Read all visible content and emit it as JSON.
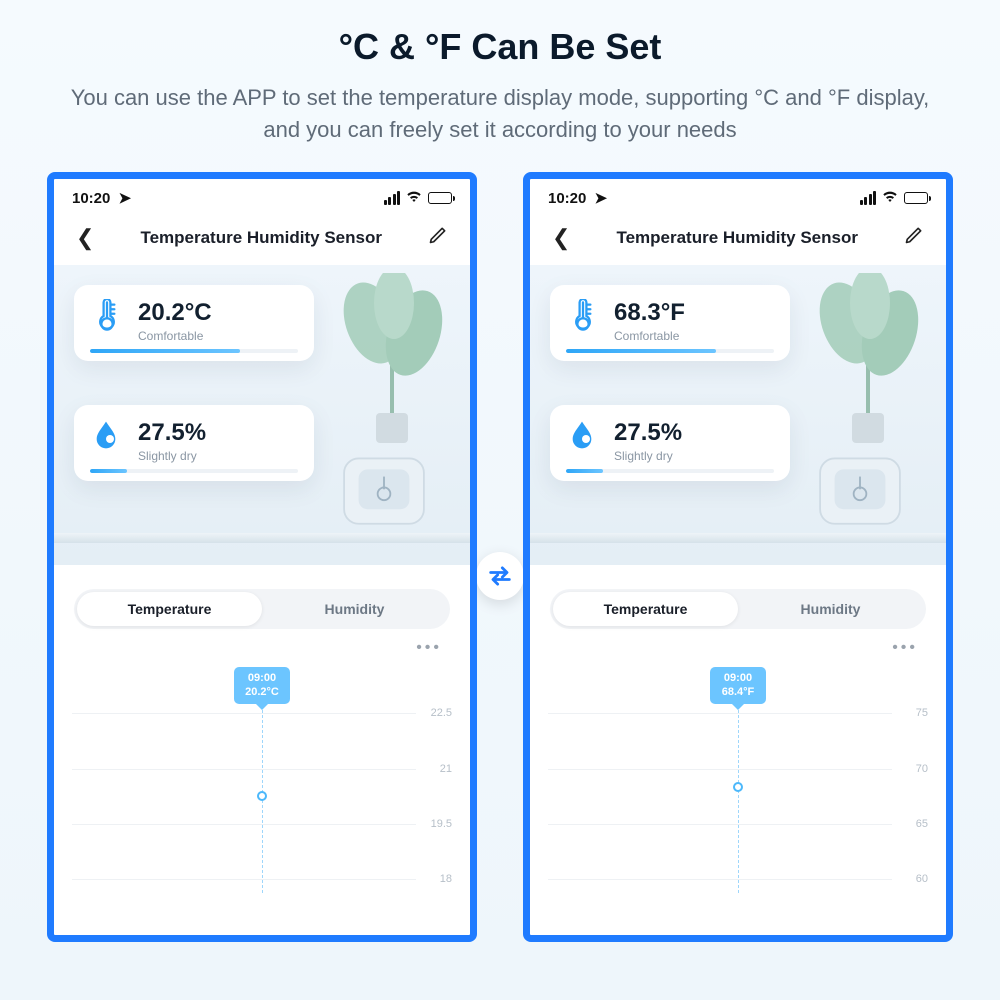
{
  "header": {
    "title": "°C & °F Can Be Set",
    "description": "You can use the APP to set the temperature display mode, supporting °C and °F display, and you can freely set it according to your needs"
  },
  "swap_icon": "swap-horizontal",
  "phones": {
    "left": {
      "statusbar": {
        "time": "10:20"
      },
      "nav_title": "Temperature Humidity Sensor",
      "temperature": {
        "value": "20.2°C",
        "status": "Comfortable"
      },
      "humidity": {
        "value": "27.5%",
        "status": "Slightly dry"
      },
      "tabs": {
        "a": "Temperature",
        "b": "Humidity"
      },
      "chart": {
        "tooltip_time": "09:00",
        "tooltip_value": "20.2°C",
        "y_ticks": [
          "22.5",
          "21",
          "19.5",
          "18"
        ]
      }
    },
    "right": {
      "statusbar": {
        "time": "10:20"
      },
      "nav_title": "Temperature Humidity Sensor",
      "temperature": {
        "value": "68.3°F",
        "status": "Comfortable"
      },
      "humidity": {
        "value": "27.5%",
        "status": "Slightly dry"
      },
      "tabs": {
        "a": "Temperature",
        "b": "Humidity"
      },
      "chart": {
        "tooltip_time": "09:00",
        "tooltip_value": "68.4°F",
        "y_ticks": [
          "75",
          "70",
          "65",
          "60"
        ]
      }
    }
  }
}
